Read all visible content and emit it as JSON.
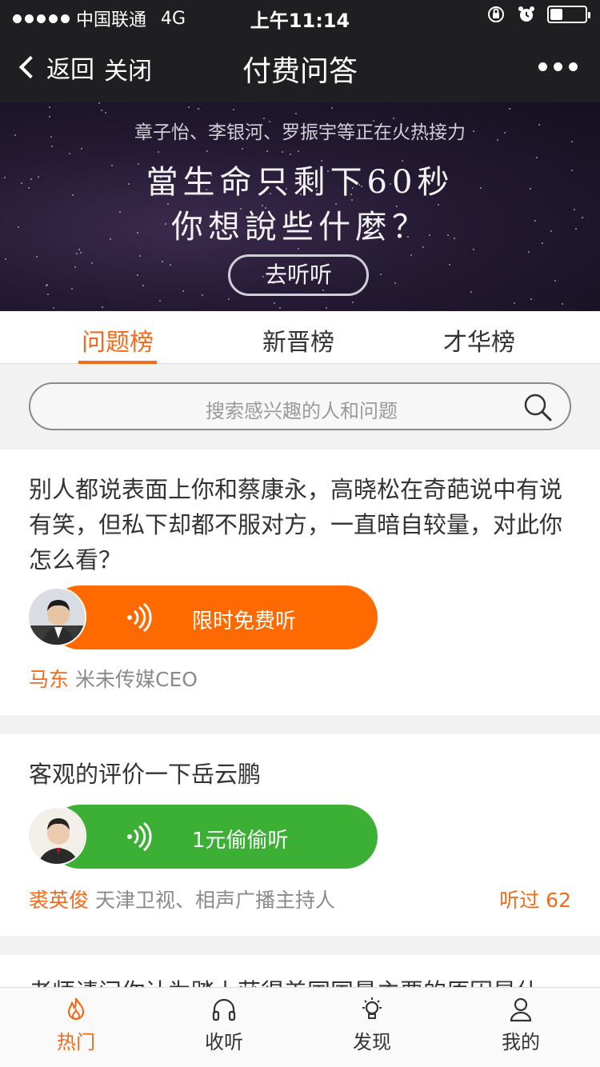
{
  "status": {
    "carrier": "中国联通",
    "network": "4G",
    "time": "上午11:14",
    "battery": 0.35
  },
  "nav": {
    "back_label": "返回",
    "close_label": "关闭",
    "title": "付费问答"
  },
  "banner": {
    "subtitle": "章子怡、李银河、罗振宇等正在火热接力",
    "headline_line1": "當生命只剩下60秒",
    "headline_line2": "你想說些什麼？",
    "button_label": "去听听"
  },
  "tabs": [
    "问题榜",
    "新晋榜",
    "才华榜"
  ],
  "search": {
    "placeholder": "搜索感兴趣的人和问题"
  },
  "questions": [
    {
      "text": "别人都说表面上你和蔡康永，高晓松在奇葩说中有说有笑，但私下却都不服对方，一直暗自较量，对此你怎么看？",
      "button_label": "限时免费听",
      "button_color": "#ff6a00",
      "answerer_name": "马东",
      "answerer_title": "米未传媒CEO"
    },
    {
      "text": "客观的评价一下岳云鹏",
      "button_label": "1元偷偷听",
      "button_color": "#3cb034",
      "answerer_name": "裘英俊",
      "answerer_title": "天津卫视、相声广播主持人",
      "listened": "听过 62"
    },
    {
      "text": "老师请问你认为踏上获得美国国最主要的原因是什"
    }
  ],
  "tabbar": [
    {
      "label": "热门",
      "icon": "flame-icon"
    },
    {
      "label": "收听",
      "icon": "headphones-icon"
    },
    {
      "label": "发现",
      "icon": "lightbulb-icon"
    },
    {
      "label": "我的",
      "icon": "person-icon"
    }
  ],
  "colors": {
    "accent": "#f26b1d",
    "navbar": "#1f1f22"
  }
}
